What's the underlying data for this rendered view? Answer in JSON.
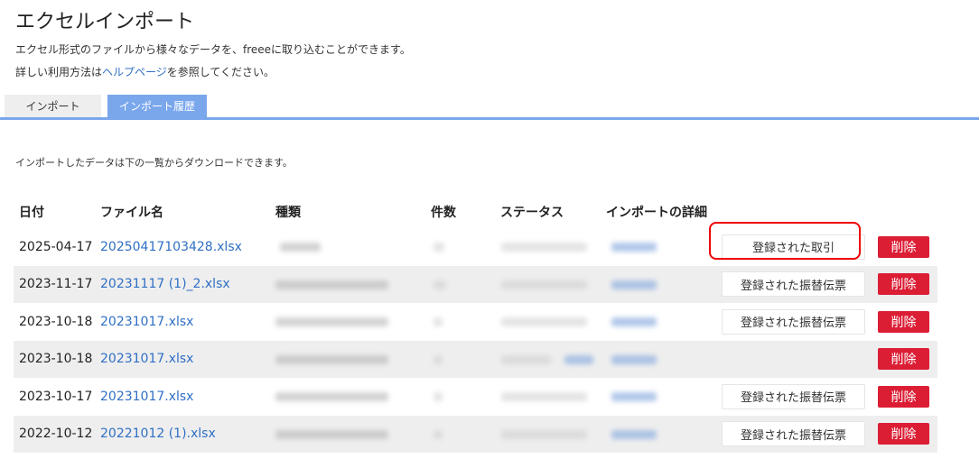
{
  "page": {
    "title": "エクセルインポート",
    "desc1": "エクセル形式のファイルから様々なデータを、freeeに取り込むことができます。",
    "desc2_before": "詳しい利用方法は",
    "desc2_link": "ヘルプページ",
    "desc2_after": "を参照してください。"
  },
  "tabs": {
    "import": "インポート",
    "history": "インポート履歴"
  },
  "intro": "インポートしたデータは下の一覧からダウンロードできます。",
  "table": {
    "headers": {
      "date": "日付",
      "file": "ファイル名",
      "type": "種類",
      "count": "件数",
      "status": "ステータス",
      "detail": "インポートの詳細"
    },
    "rows": [
      {
        "date": "2025-04-17",
        "file": "20250417103428.xlsx",
        "detail": "登録された取引",
        "delete": "削除"
      },
      {
        "date": "2023-11-17",
        "file": "20231117 (1)_2.xlsx",
        "detail": "登録された振替伝票",
        "delete": "削除"
      },
      {
        "date": "2023-10-18",
        "file": "20231017.xlsx",
        "detail": "登録された振替伝票",
        "delete": "削除"
      },
      {
        "date": "2023-10-18",
        "file": "20231017.xlsx",
        "detail": "",
        "delete": "削除"
      },
      {
        "date": "2023-10-17",
        "file": "20231017.xlsx",
        "detail": "登録された振替伝票",
        "delete": "削除"
      },
      {
        "date": "2022-10-12",
        "file": "20221012 (1).xlsx",
        "detail": "登録された振替伝票",
        "delete": "削除"
      }
    ]
  },
  "colors": {
    "accent": "#7aa7ec",
    "link": "#2f6fc4",
    "danger": "#dc1e35",
    "highlight": "#ee0000"
  }
}
